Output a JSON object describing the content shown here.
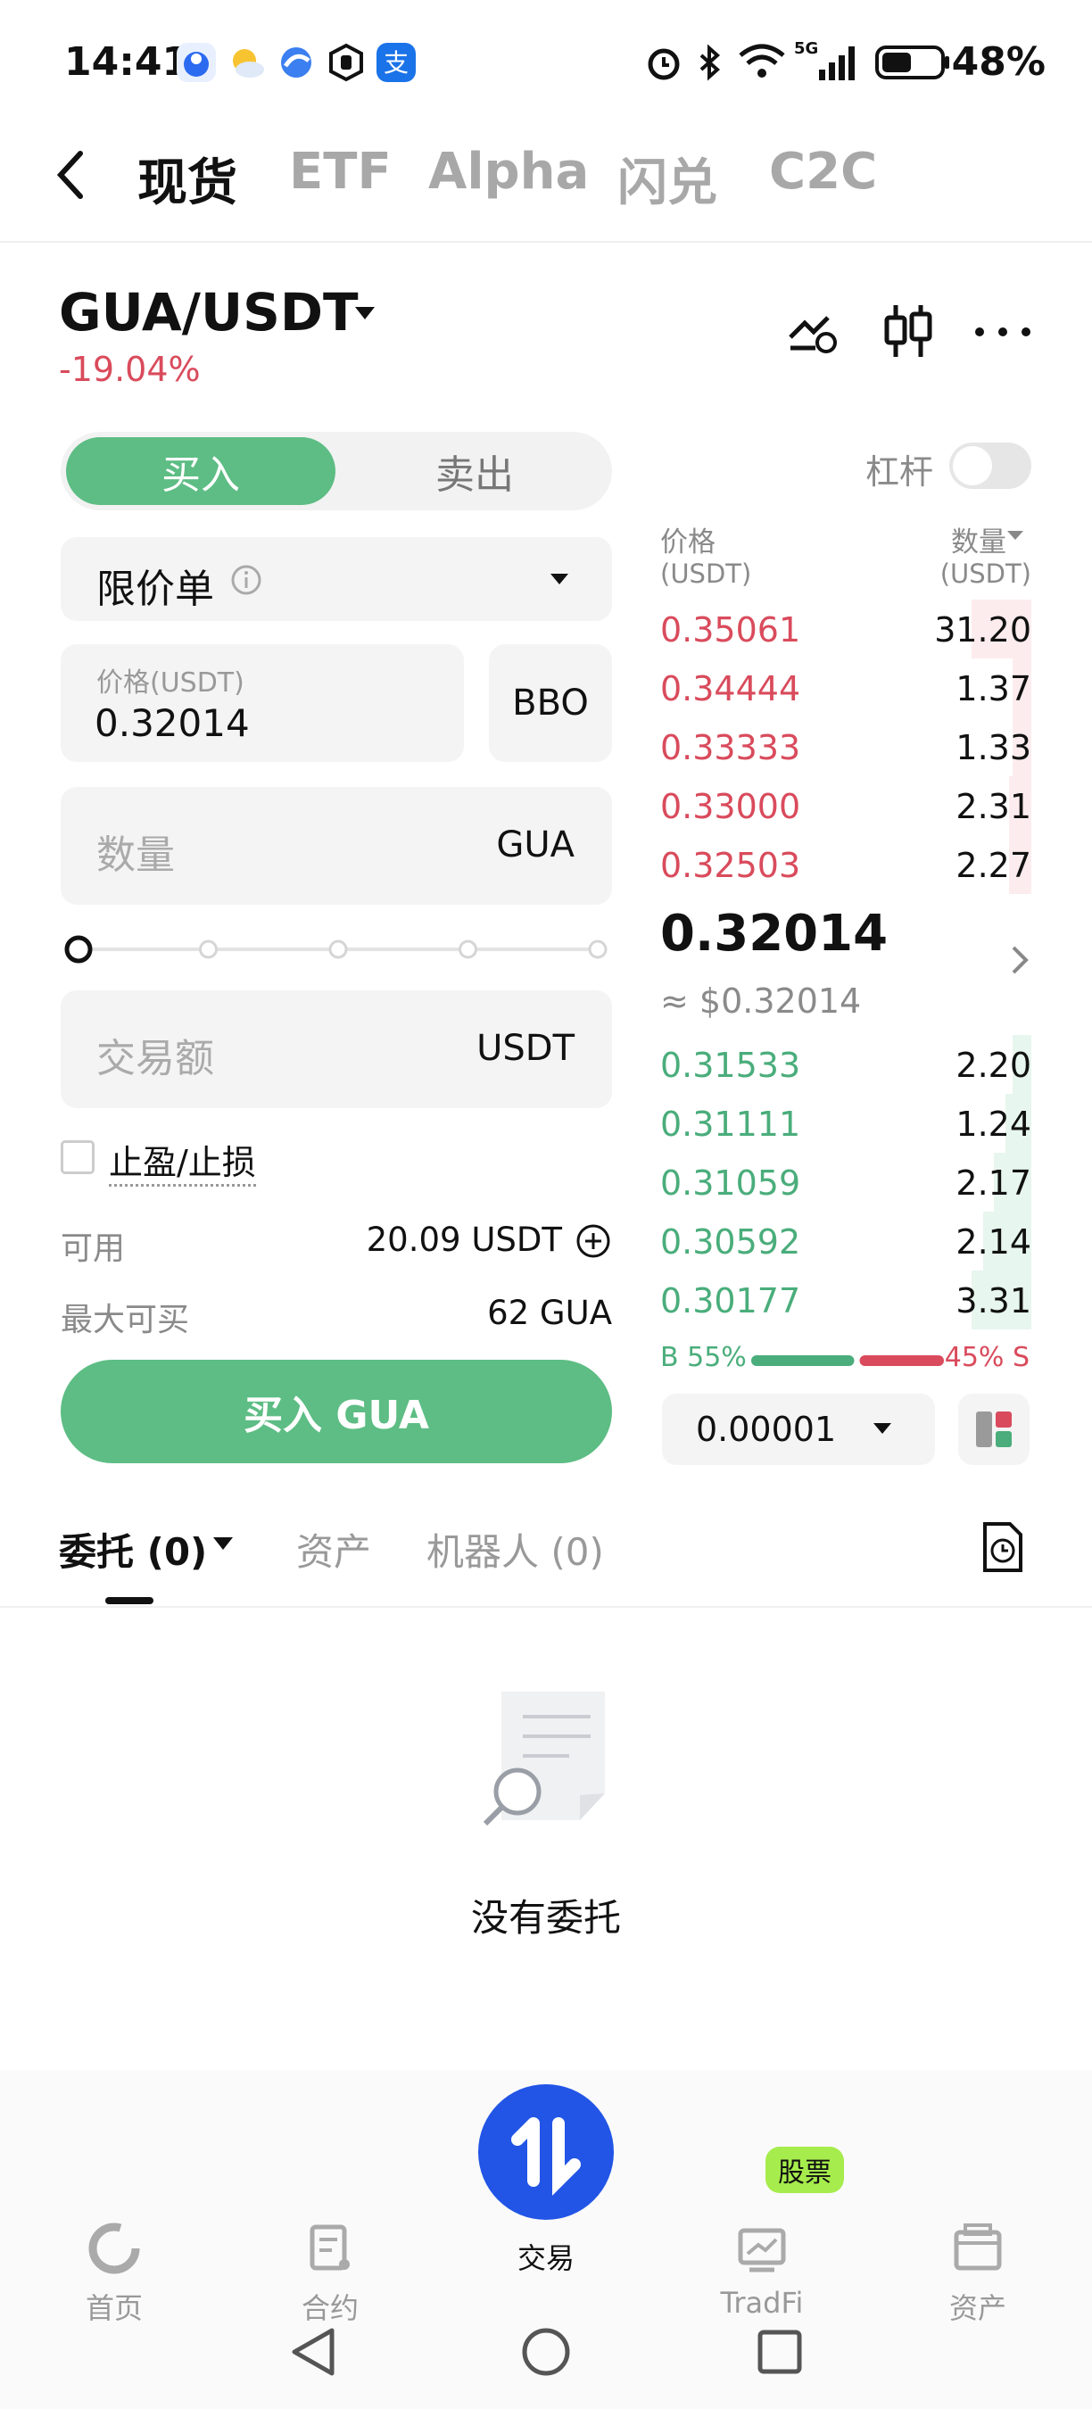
{
  "status_bar": {
    "time": "14:41",
    "battery": "48%",
    "network": "5G",
    "icons": [
      "app-notification-icon",
      "weather-icon",
      "browser-icon",
      "hand-icon",
      "alipay-icon",
      "alarm-icon",
      "bluetooth-icon",
      "wifi-icon",
      "signal-icon",
      "battery-icon"
    ]
  },
  "nav": {
    "tabs": [
      "现货",
      "ETF",
      "Alpha",
      "闪兑",
      "C2C"
    ],
    "active": "现货"
  },
  "pair": {
    "symbol": "GUA/USDT",
    "change": "-19.04%"
  },
  "order_form": {
    "buy_label": "买入",
    "sell_label": "卖出",
    "order_type": "限价单",
    "price_label": "价格(USDT)",
    "price_value": "0.32014",
    "bbo_label": "BBO",
    "amount_placeholder": "数量",
    "amount_unit": "GUA",
    "total_placeholder": "交易额",
    "total_unit": "USDT",
    "tpsl_label": "止盈/止损",
    "available_label": "可用",
    "available_value": "20.09 USDT",
    "max_buy_label": "最大可买",
    "max_buy_value": "62 GUA",
    "submit_label": "买入 GUA",
    "slider_percent": 0
  },
  "order_book": {
    "leverage_label": "杠杆",
    "price_header": "价格",
    "price_unit": "(USDT)",
    "qty_header": "数量",
    "qty_unit": "(USDT)",
    "asks": [
      {
        "price": "0.35061",
        "qty": "31.20",
        "depth": 0.16
      },
      {
        "price": "0.34444",
        "qty": "1.37",
        "depth": 0.05
      },
      {
        "price": "0.33333",
        "qty": "1.33",
        "depth": 0.05
      },
      {
        "price": "0.33000",
        "qty": "2.31",
        "depth": 0.06
      },
      {
        "price": "0.32503",
        "qty": "2.27",
        "depth": 0.06
      }
    ],
    "last_price": "0.32014",
    "last_price_usd": "≈ $0.32014",
    "bids": [
      {
        "price": "0.31533",
        "qty": "2.20",
        "depth": 0.05
      },
      {
        "price": "0.31111",
        "qty": "1.24",
        "depth": 0.07
      },
      {
        "price": "0.31059",
        "qty": "2.17",
        "depth": 0.1
      },
      {
        "price": "0.30592",
        "qty": "2.14",
        "depth": 0.13
      },
      {
        "price": "0.30177",
        "qty": "3.31",
        "depth": 0.16
      }
    ],
    "buy_ratio_label": "B 55%",
    "sell_ratio_label": "45% S",
    "buy_ratio": 0.55,
    "precision": "0.00001"
  },
  "orders": {
    "tabs": [
      "委托 (0)",
      "资产",
      "机器人 (0)"
    ],
    "empty_text": "没有委托"
  },
  "bottom_nav": {
    "items": [
      "首页",
      "合约",
      "交易",
      "TradFi",
      "资产"
    ],
    "active": "交易",
    "badge": "股票"
  },
  "colors": {
    "buy": "#5dbd84",
    "sell": "#d94b5c",
    "accent": "#2255e6"
  }
}
